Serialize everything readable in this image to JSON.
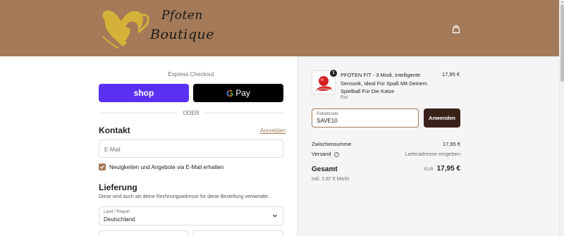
{
  "header": {
    "logo_line1": "Pfoten",
    "logo_line2": "Boutique",
    "cart_icon": "shopping-bag-icon"
  },
  "express": {
    "label": "Express Checkout",
    "shop_label": "shop",
    "gpay_g": "G",
    "gpay_label": "Pay",
    "divider": "ODER"
  },
  "contact": {
    "heading": "Kontakt",
    "login_link": "Anmelden",
    "email_placeholder": "E-Mail",
    "newsletter_label": "Neuigkeiten und Angebote via E-Mail erhalten",
    "newsletter_checked": true
  },
  "delivery": {
    "heading": "Lieferung",
    "hint": "Diese wird auch als deine Rechnungsadresse für diese Bestellung verwendet.",
    "country_label": "Land / Region",
    "country_value": "Deutschland"
  },
  "summary": {
    "product": {
      "quantity": "1",
      "title": "PFOTEN FIT - 3 Modi, Intelligente Sensorik, Ideal Für Spaß Mit Deinem Spielball Für Die Katze",
      "variant": "Rot",
      "price": "17,95 €"
    },
    "discount_label": "Rabattcode",
    "discount_value": "SAVE10",
    "apply_label": "Anwenden",
    "subtotal_label": "Zwischensumme",
    "subtotal_value": "17,95 €",
    "shipping_label": "Versand",
    "shipping_value": "Lieferadresse eingeben",
    "total_label": "Gesamt",
    "total_currency": "EUR",
    "total_value": "17,95 €",
    "tax_note": "inkl. 2,87 € MwSt"
  },
  "colors": {
    "brand": "#a47a58",
    "shop_pay": "#5a31f4",
    "apply_button": "#3b2218"
  }
}
